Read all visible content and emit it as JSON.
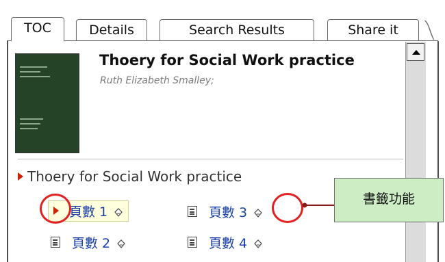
{
  "tabs": [
    {
      "label": "TOC",
      "active": true
    },
    {
      "label": "Details",
      "active": false
    },
    {
      "label": "Search Results",
      "active": false
    },
    {
      "label": "Share it",
      "active": false
    }
  ],
  "book": {
    "title": "Thoery for Social Work practice",
    "author": "Ruth Elizabeth Smalley;"
  },
  "toc": {
    "root_label": "Thoery for Social Work practice",
    "pages": [
      {
        "label": "頁數 1",
        "selected": true
      },
      {
        "label": "頁數 3",
        "selected": false
      },
      {
        "label": "頁數 2",
        "selected": false
      },
      {
        "label": "頁數 4",
        "selected": false
      }
    ]
  },
  "annotation": {
    "callout_text": "書籤功能",
    "callout_color": "#cdeec4",
    "highlight_color": "#e02424",
    "arrow_color": "#8b1a1a"
  },
  "icons": [
    "scroll-up-arrow-icon",
    "expand-triangle-icon",
    "page-doc-icon",
    "bookmark-icon"
  ]
}
